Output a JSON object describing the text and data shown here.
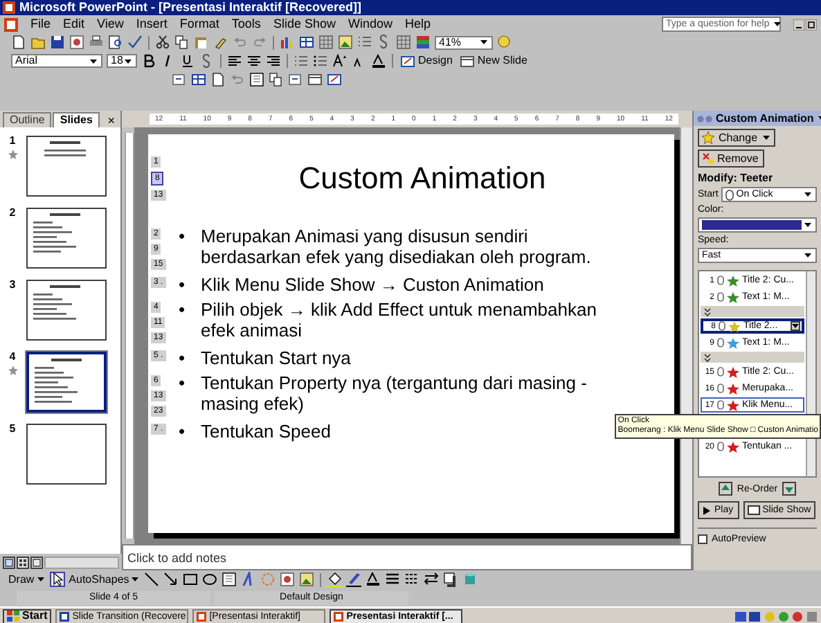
{
  "window": {
    "title": "Microsoft PowerPoint - [Presentasi Interaktif [Recovered]]"
  },
  "menu": [
    "File",
    "Edit",
    "View",
    "Insert",
    "Format",
    "Tools",
    "Slide Show",
    "Window",
    "Help"
  ],
  "help_box": {
    "placeholder": "Type a question for help"
  },
  "standard_toolbar": {
    "zoom": "41%"
  },
  "formatting_toolbar": {
    "font": "Arial",
    "size": "18",
    "design_button": "Design",
    "new_slide_button": "New Slide"
  },
  "slides_pane": {
    "tabs": [
      {
        "label": "Outline",
        "selected": false
      },
      {
        "label": "Slides",
        "selected": true
      }
    ],
    "close": "×",
    "slides": [
      {
        "number": "1",
        "animated": true,
        "selected": false
      },
      {
        "number": "2",
        "animated": false,
        "selected": false
      },
      {
        "number": "3",
        "animated": false,
        "selected": false
      },
      {
        "number": "4",
        "animated": true,
        "selected": true
      },
      {
        "number": "5",
        "animated": false,
        "selected": false
      }
    ]
  },
  "ruler": [
    "12",
    "11",
    "10",
    "9",
    "8",
    "7",
    "6",
    "5",
    "4",
    "3",
    "2",
    "1",
    "0",
    "1",
    "2",
    "3",
    "4",
    "5",
    "6",
    "7",
    "8",
    "9",
    "10",
    "11",
    "12"
  ],
  "slide": {
    "title": "Custom Animation",
    "title_tags": [
      {
        "text": "1",
        "selected": false
      },
      {
        "text": "8",
        "selected": true
      },
      {
        "text": "13",
        "selected": false
      }
    ],
    "bullets": [
      {
        "bullet": "•",
        "text": "Merupakan Animasi yang disusun sendiri berdasarkan efek yang disediakan oleh program.",
        "tags": [
          "2",
          "9",
          "15"
        ]
      },
      {
        "bullet": "•",
        "text": "Klik Menu Slide Show → Custon Animation",
        "tags": [
          "3 ."
        ]
      },
      {
        "bullet": "•",
        "text": "Pilih objek → klik Add Effect untuk menambahkan efek animasi",
        "tags": [
          "4",
          "11",
          "13"
        ]
      },
      {
        "bullet": "•",
        "text": "Tentukan Start nya",
        "tags": [
          "5 ."
        ]
      },
      {
        "bullet": "•",
        "text": "Tentukan Property nya (tergantung dari masing - masing efek)",
        "tags": [
          "6",
          "13",
          "23"
        ]
      },
      {
        "bullet": "•",
        "text": "Tentukan Speed",
        "tags": [
          "7 ."
        ]
      }
    ]
  },
  "notes": {
    "placeholder": "Click to add notes"
  },
  "task_pane": {
    "title": "Custom Animation",
    "change_button": "Change",
    "remove_button": "Remove",
    "modify_label": "Modify: Teeter",
    "start_label": "Start",
    "start_value": "On Click",
    "color_label": "Color:",
    "speed_label": "Speed:",
    "speed_value": "Fast",
    "items": [
      {
        "kind": "effect",
        "number": "1",
        "label": "Title 2: Cu...",
        "color": "#3c8c2c",
        "selected": false,
        "focused": false
      },
      {
        "kind": "effect",
        "number": "2",
        "label": "Text 1: M...",
        "color": "#3c8c2c",
        "selected": false,
        "focused": false
      },
      {
        "kind": "expander"
      },
      {
        "kind": "effect",
        "number": "8",
        "label": "Title 2...",
        "color": "#d8c020",
        "selected": true,
        "focused": false
      },
      {
        "kind": "effect",
        "number": "9",
        "label": "Text 1: M...",
        "color": "#3aa0e0",
        "selected": false,
        "focused": false
      },
      {
        "kind": "expander"
      },
      {
        "kind": "effect",
        "number": "15",
        "label": "Title 2: Cu...",
        "color": "#d02020",
        "selected": false,
        "focused": false
      },
      {
        "kind": "effect",
        "number": "16",
        "label": "Merupaka...",
        "color": "#d02020",
        "selected": false,
        "focused": false
      },
      {
        "kind": "effect",
        "number": "17",
        "label": "Klik Menu...",
        "color": "#d02020",
        "selected": false,
        "focused": true
      },
      {
        "kind": "covered"
      },
      {
        "kind": "effect",
        "number": "20",
        "label": "Tentukan ...",
        "color": "#d02020",
        "selected": false,
        "focused": false
      }
    ],
    "tooltip": {
      "title": "On Click",
      "text": "Boomerang : Klik Menu Slide Show □ Custon Animatio"
    },
    "reorder_label": "Re-Order",
    "play_button": "Play",
    "slideshow_button": "Slide Show",
    "autopreview": {
      "label": "AutoPreview",
      "checked": false
    }
  },
  "drawing_toolbar": {
    "draw_menu": "Draw",
    "autoshapes_menu": "AutoShapes"
  },
  "status_bar": [
    "Slide 4 of 5",
    "Default Design"
  ],
  "taskbar": {
    "start": "Start",
    "tasks": [
      {
        "label": "Slide Transition (Recovere",
        "selected": false
      },
      {
        "label": "[Presentasi Interaktif]",
        "selected": false
      },
      {
        "label": "Presentasi Interaktif [...",
        "selected": true
      }
    ]
  }
}
